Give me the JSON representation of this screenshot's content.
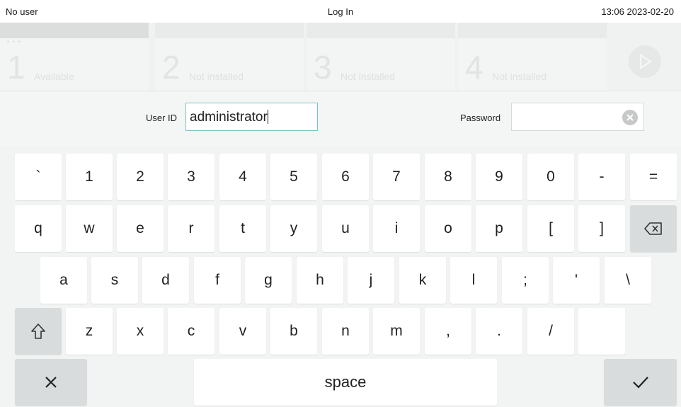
{
  "header": {
    "user": "No user",
    "title": "Log In",
    "datetime": "13:06 2023-02-20"
  },
  "slots": [
    {
      "number": "1",
      "status": "Available"
    },
    {
      "number": "2",
      "status": "Not installed"
    },
    {
      "number": "3",
      "status": "Not installed"
    },
    {
      "number": "4",
      "status": "Not installed"
    }
  ],
  "slot_dots": "• • •",
  "login": {
    "user_id_label": "User ID",
    "user_id_value": "administrator",
    "password_label": "Password",
    "password_value": ""
  },
  "keyboard": {
    "row1": [
      "`",
      "1",
      "2",
      "3",
      "4",
      "5",
      "6",
      "7",
      "8",
      "9",
      "0",
      "-",
      "="
    ],
    "row2": [
      "q",
      "w",
      "e",
      "r",
      "t",
      "y",
      "u",
      "i",
      "o",
      "p",
      "[",
      "]"
    ],
    "row3": [
      "a",
      "s",
      "d",
      "f",
      "g",
      "h",
      "j",
      "k",
      "l",
      ";",
      "'",
      "\\"
    ],
    "row4": [
      "z",
      "x",
      "c",
      "v",
      "b",
      "n",
      "m",
      ",",
      ".",
      "/",
      ""
    ],
    "space_label": "space",
    "backspace_icon": "backspace-icon",
    "shift_icon": "shift-icon",
    "cancel_icon": "close-icon",
    "confirm_icon": "check-icon"
  },
  "colors": {
    "input_focus_border": "#7cc3c3",
    "key_gray": "#d9dcdc"
  }
}
